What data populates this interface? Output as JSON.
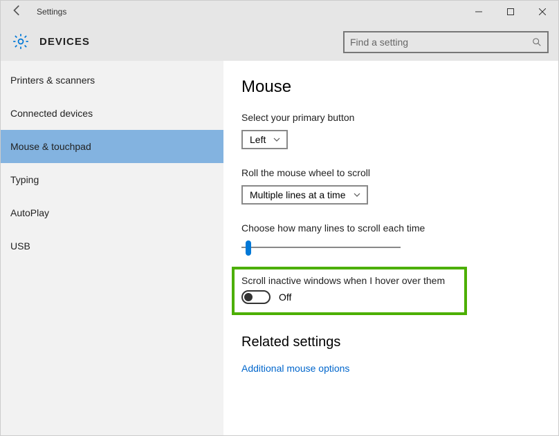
{
  "window": {
    "title": "Settings"
  },
  "header": {
    "category": "DEVICES"
  },
  "search": {
    "placeholder": "Find a setting"
  },
  "sidebar": {
    "items": [
      {
        "label": "Printers & scanners"
      },
      {
        "label": "Connected devices"
      },
      {
        "label": "Mouse & touchpad"
      },
      {
        "label": "Typing"
      },
      {
        "label": "AutoPlay"
      },
      {
        "label": "USB"
      }
    ],
    "active_index": 2
  },
  "main": {
    "heading": "Mouse",
    "primary_button": {
      "label": "Select your primary button",
      "value": "Left"
    },
    "scroll_wheel": {
      "label": "Roll the mouse wheel to scroll",
      "value": "Multiple lines at a time"
    },
    "lines_slider": {
      "label": "Choose how many lines to scroll each time"
    },
    "inactive_scroll": {
      "label": "Scroll inactive windows when I hover over them",
      "state": "Off"
    },
    "related_heading": "Related settings",
    "related_link": "Additional mouse options"
  }
}
